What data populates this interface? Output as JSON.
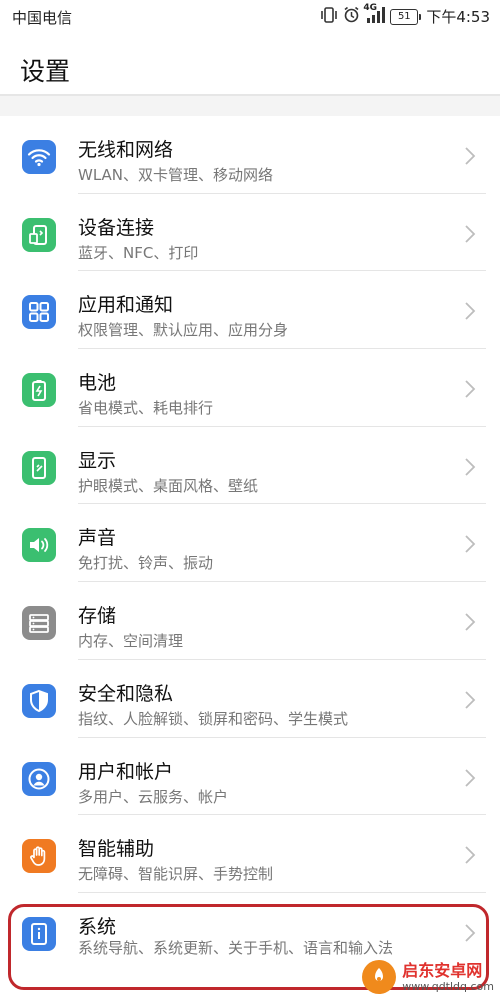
{
  "status_bar": {
    "carrier": "中国电信",
    "network": "4G",
    "battery": "51",
    "time": "下午4:53"
  },
  "page": {
    "title": "设置"
  },
  "settings": [
    {
      "title": "无线和网络",
      "subtitle": "WLAN、双卡管理、移动网络",
      "icon": "wifi-icon",
      "color": "#3b7fe3"
    },
    {
      "title": "设备连接",
      "subtitle": "蓝牙、NFC、打印",
      "icon": "device-connection-icon",
      "color": "#3bbf70"
    },
    {
      "title": "应用和通知",
      "subtitle": "权限管理、默认应用、应用分身",
      "icon": "apps-icon",
      "color": "#3b7fe3"
    },
    {
      "title": "电池",
      "subtitle": "省电模式、耗电排行",
      "icon": "battery-icon",
      "color": "#3bbf70"
    },
    {
      "title": "显示",
      "subtitle": "护眼模式、桌面风格、壁纸",
      "icon": "display-icon",
      "color": "#3bbf70"
    },
    {
      "title": "声音",
      "subtitle": "免打扰、铃声、振动",
      "icon": "sound-icon",
      "color": "#3bbf70"
    },
    {
      "title": "存储",
      "subtitle": "内存、空间清理",
      "icon": "storage-icon",
      "color": "#8c8c8c"
    },
    {
      "title": "安全和隐私",
      "subtitle": "指纹、人脸解锁、锁屏和密码、学生模式",
      "icon": "shield-icon",
      "color": "#3b7fe3"
    },
    {
      "title": "用户和帐户",
      "subtitle": "多用户、云服务、帐户",
      "icon": "user-icon",
      "color": "#3b7fe3"
    },
    {
      "title": "智能辅助",
      "subtitle": "无障碍、智能识屏、手势控制",
      "icon": "hand-icon",
      "color": "#f07a22"
    },
    {
      "title": "系统",
      "subtitle": "系统导航、系统更新、关于手机、语言和输入法",
      "icon": "system-info-icon",
      "color": "#3b7fe3"
    }
  ],
  "watermark": {
    "name": "启东安卓网",
    "url": "www.qdtldq.com"
  }
}
